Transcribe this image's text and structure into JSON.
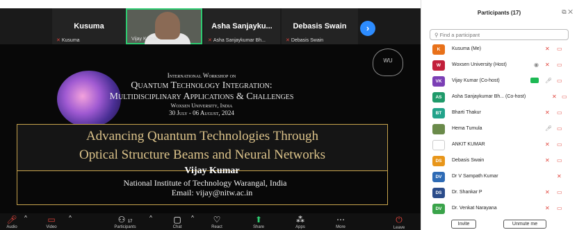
{
  "tiles": [
    {
      "name": "Kusuma",
      "label": "Kusuma"
    },
    {
      "name": "",
      "label": "Vijay Kumar"
    },
    {
      "name": "Asha Sanjayku...",
      "label": "Asha Sanjaykumar Bh..."
    },
    {
      "name": "Debasis Swain",
      "label": "Debasis Swain"
    }
  ],
  "slide": {
    "logo_text": "WU",
    "line1": "International Workshop on",
    "line2": "Quantum Technology Integration:",
    "line3": "Multidisciplinary Applications & Challenges",
    "line4": "Woxsen University, India",
    "line5": "30 July - 06 August, 2024",
    "title_line1": "Advancing Quantum Technologies Through",
    "title_line2": "Optical Structure Beams and Neural Networks",
    "author": "Vijay Kumar",
    "institute": "National Institute of Technology Warangal, India",
    "email": "Email: vijay@nitw.ac.in"
  },
  "toolbar": {
    "audio": "Audio",
    "video": "Video",
    "participants": "Participants",
    "participants_count": "17",
    "chat": "Chat",
    "react": "React",
    "share": "Share",
    "apps": "Apps",
    "more": "More",
    "leave": "Leave"
  },
  "participants_panel": {
    "title": "Participants (17)",
    "search_placeholder": "Find a participant",
    "items": [
      {
        "initials": "K",
        "name": "Kusuma (Me)",
        "color": "#e8711a"
      },
      {
        "initials": "W",
        "name": "Woxsen University (Host)",
        "color": "#c21f3a"
      },
      {
        "initials": "VK",
        "name": "Vijay Kumar (Co-host)",
        "color": "#7b3fb5"
      },
      {
        "initials": "AS",
        "name": "Asha Sanjaykumar Bh... (Co-host)",
        "color": "#1f9a6a"
      },
      {
        "initials": "BT",
        "name": "Bharti Thakur",
        "color": "#22a38a"
      },
      {
        "initials": "",
        "name": "Hema Tumula",
        "color": "#6a8a4a"
      },
      {
        "initials": "",
        "name": "ANKIT KUMAR",
        "color": "#ffffff"
      },
      {
        "initials": "DS",
        "name": "Debasis Swain",
        "color": "#e8961a"
      },
      {
        "initials": "DV",
        "name": "Dr V Sampath Kumar",
        "color": "#2e6bb5"
      },
      {
        "initials": "DS",
        "name": "Dr. Shankar P",
        "color": "#2b4c8a"
      },
      {
        "initials": "DV",
        "name": "Dr. Venkat Narayana",
        "color": "#3aa34a"
      }
    ],
    "invite": "Invite",
    "unmute": "Unmute me"
  }
}
